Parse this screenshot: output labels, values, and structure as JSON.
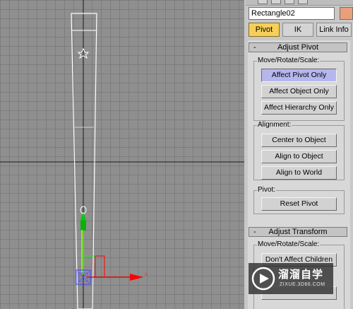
{
  "viewport": {
    "axis_label": "x"
  },
  "panel": {
    "object_name": "Rectangle02",
    "tabs": [
      "Pivot",
      "IK",
      "Link Info"
    ],
    "active_tab": "Pivot",
    "colors": {
      "swatch": "#e8a07a",
      "active_tab": "#f5cf5a",
      "pressed_button": "#b6b6ee"
    },
    "adjust_pivot": {
      "sign": "-",
      "title": "Adjust Pivot",
      "move_group_label": "Move/Rotate/Scale:",
      "affect_pivot_only": "Affect Pivot Only",
      "affect_object_only": "Affect Object Only",
      "affect_hierarchy_only": "Affect Hierarchy Only",
      "alignment_group_label": "Alignment:",
      "center_to_object": "Center to Object",
      "align_to_object": "Align to Object",
      "align_to_world": "Align to World",
      "pivot_group_label": "Pivot:",
      "reset_pivot": "Reset Pivot"
    },
    "adjust_transform": {
      "sign": "-",
      "title": "Adjust Transform",
      "move_group_label": "Move/Rotate/Scale:",
      "dont_affect_children": "Don't Affect Children"
    }
  },
  "watermark": {
    "main": "溜溜自学",
    "sub": "ZIXUE.3D66.COM"
  }
}
